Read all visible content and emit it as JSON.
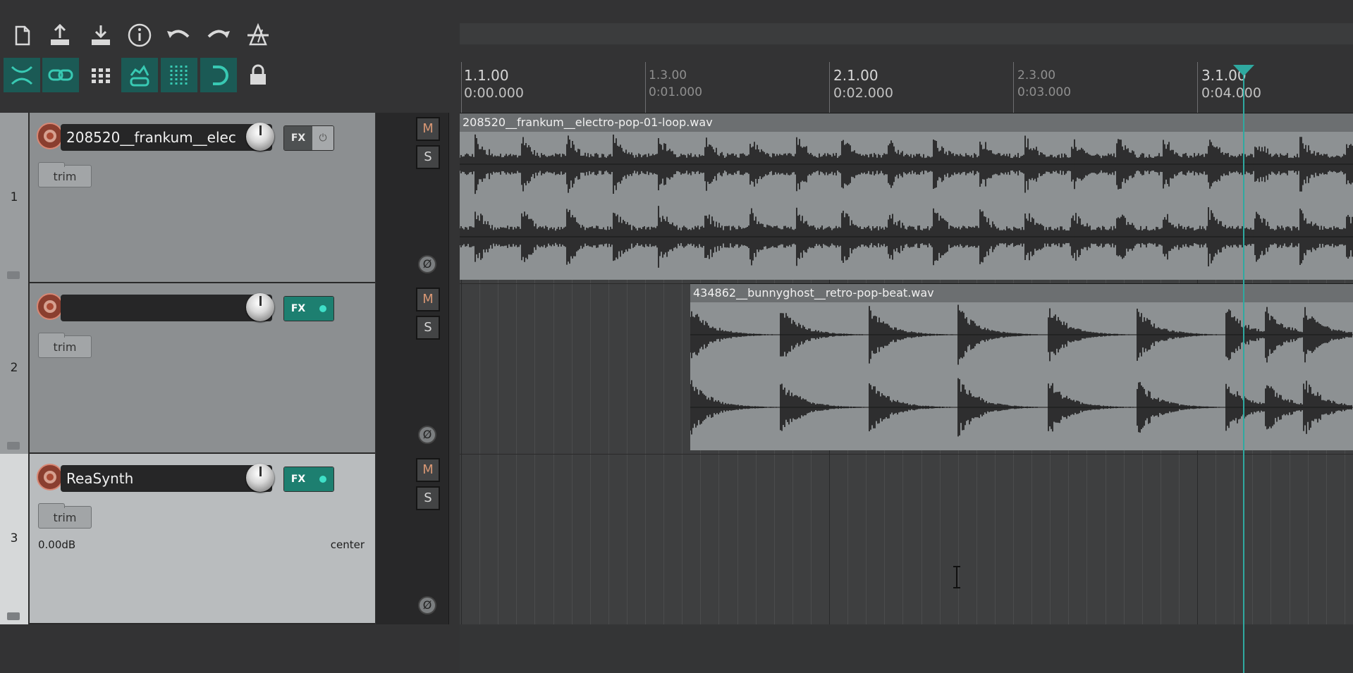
{
  "toolbar": {
    "row1": [
      "new-project-icon",
      "save-project-icon",
      "load-project-icon",
      "info-icon",
      "undo-icon",
      "redo-icon",
      "metronome-icon"
    ],
    "row2": [
      "ripple-edit-icon",
      "item-grouping-icon",
      "grid-icon",
      "envelope-link-icon",
      "snap-grid-icon",
      "auto-crossfade-icon",
      "lock-icon"
    ]
  },
  "ruler": {
    "markers": [
      {
        "bar": "1.1.00",
        "time": "0:00.000",
        "major": true
      },
      {
        "bar": "1.3.00",
        "time": "0:01.000",
        "major": false
      },
      {
        "bar": "2.1.00",
        "time": "0:02.000",
        "major": true
      },
      {
        "bar": "2.3.00",
        "time": "0:03.000",
        "major": false
      },
      {
        "bar": "3.1.00",
        "time": "0:04.000",
        "major": true
      }
    ]
  },
  "tracks": [
    {
      "number": "1",
      "name": "208520__frankum__elec",
      "fx_label": "FX",
      "fx_active": false,
      "trim_label": "trim",
      "mute": "M",
      "solo": "S",
      "phase": "Ø",
      "selected": false
    },
    {
      "number": "2",
      "name": "",
      "fx_label": "FX",
      "fx_active": true,
      "trim_label": "trim",
      "mute": "M",
      "solo": "S",
      "phase": "Ø",
      "selected": false
    },
    {
      "number": "3",
      "name": "ReaSynth",
      "fx_label": "FX",
      "fx_active": true,
      "trim_label": "trim",
      "mute": "M",
      "solo": "S",
      "phase": "Ø",
      "selected": true,
      "volume": "0.00dB",
      "pan": "center"
    }
  ],
  "items": [
    {
      "track": 1,
      "name": "208520__frankum__electro-pop-01-loop.wav"
    },
    {
      "track": 2,
      "name": "434862__bunnyghost__retro-pop-beat.wav"
    }
  ],
  "colors": {
    "accent": "#38c9b3",
    "playcursor": "#2fa9a0",
    "record": "#8a3e2f"
  }
}
